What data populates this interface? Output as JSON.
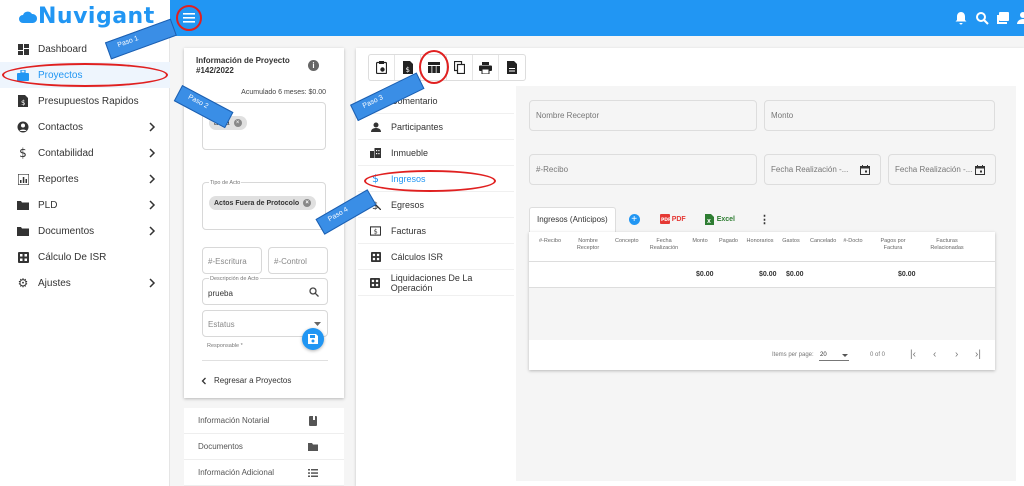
{
  "app": {
    "brand": "Nuvigant"
  },
  "sidebar": {
    "items": [
      {
        "label": "Dashboard",
        "icon": "dashboard-icon"
      },
      {
        "label": "Proyectos",
        "icon": "briefcase-icon"
      },
      {
        "label": "Presupuestos Rapidos",
        "icon": "budget-icon"
      },
      {
        "label": "Contactos",
        "icon": "contacts-icon"
      },
      {
        "label": "Contabilidad",
        "icon": "dollar-icon"
      },
      {
        "label": "Reportes",
        "icon": "reports-icon"
      },
      {
        "label": "PLD",
        "icon": "folder-icon"
      },
      {
        "label": "Documentos",
        "icon": "folder-icon"
      },
      {
        "label": "Cálculo De ISR",
        "icon": "calculator-icon"
      },
      {
        "label": "Ajustes",
        "icon": "gear-icon"
      }
    ]
  },
  "project": {
    "title": "Información de Proyecto",
    "number": "#142/2022",
    "accumulated": "Acumulado 6 meses: $0.00",
    "chip_client": "a a a",
    "tipo_label": "Tipo de Acto",
    "tipo_chip": "Actos Fuera de Protocolo",
    "escritura_placeholder": "#-Escritura",
    "control_placeholder": "#-Control",
    "descripcion_label": "Descripción de Acto",
    "descripcion_value": "prueba",
    "estatus_placeholder": "Estatus",
    "responsable_label": "Responsable *",
    "back_link": "Regresar a Proyectos"
  },
  "sub_cards": [
    {
      "label": "Información Notarial"
    },
    {
      "label": "Documentos"
    },
    {
      "label": "Información Adicional"
    }
  ],
  "left_menu": {
    "items": [
      {
        "label": "Comentario"
      },
      {
        "label": "Participantes"
      },
      {
        "label": "Inmueble"
      },
      {
        "label": "Ingresos"
      },
      {
        "label": "Egresos"
      },
      {
        "label": "Facturas"
      },
      {
        "label": "Cálculos ISR"
      },
      {
        "label": "Liquidaciones De La Operación"
      }
    ]
  },
  "form": {
    "nombre_receptor": "Nombre Receptor",
    "monto": "Monto",
    "recibo": "#-Recibo",
    "fecha1": "Fecha Realización -...",
    "fecha2": "Fecha Realización -..."
  },
  "tabs": {
    "ingresos": "Ingresos (Anticipos)",
    "pdf": "PDF",
    "excel": "Excel"
  },
  "table": {
    "headers": [
      "#-Recibo",
      "Nombre Receptor",
      "Concepto",
      "Fecha Realización",
      "Monto",
      "Pagado",
      "Honorarios",
      "Gastos",
      "Cancelado",
      "#-Docto",
      "Pagos por Factura",
      "Facturas Relacionadas"
    ],
    "totals": {
      "monto": "$0.00",
      "honorarios": "$0.00",
      "gastos": "$0.00",
      "pagos": "$0.00"
    },
    "items_per_page_label": "Items per page:",
    "items_per_page": "20",
    "range": "0 of 0"
  },
  "annotations": {
    "paso1": "Paso 1",
    "paso2": "Paso 2",
    "paso3": "Paso 3",
    "paso4": "Paso 4"
  },
  "colors": {
    "primary": "#2196f3",
    "annotation_red": "#e02020",
    "arrow_blue": "#3a8ee6"
  }
}
